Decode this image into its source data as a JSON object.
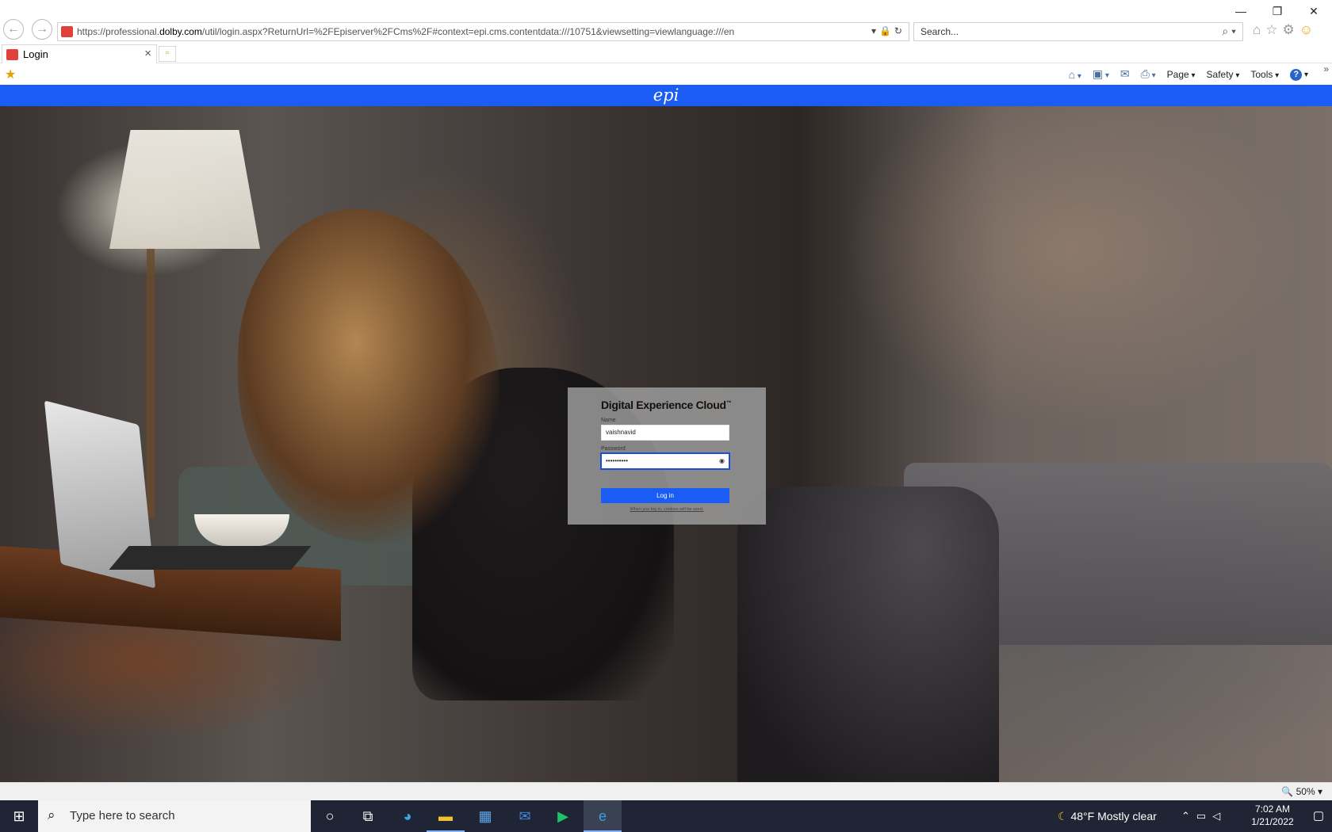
{
  "browser": {
    "url_prefix": "https://professional.",
    "url_domain": "dolby.com",
    "url_suffix": "/util/login.aspx?ReturnUrl=%2FEpiserver%2FCms%2F#context=epi.cms.contentdata:///10751&viewsetting=viewlanguage:///en",
    "search_placeholder": "Search...",
    "tab_title": "Login",
    "commands": {
      "page": "Page",
      "safety": "Safety",
      "tools": "Tools",
      "help": "?"
    },
    "zoom": "50%"
  },
  "epi": {
    "logo": "epi"
  },
  "login": {
    "brand": "Digital Experience Cloud",
    "brand_tm": "™",
    "name_label": "Name",
    "name_value": "vaishnavid",
    "password_label": "Password",
    "password_value": "••••••••••",
    "login_button": "Log in",
    "cookie_note": "When you log in, cookies will be used."
  },
  "taskbar": {
    "search_placeholder": "Type here to search",
    "weather_temp": "48°F",
    "weather_text": "Mostly clear",
    "time": "7:02 AM",
    "date": "1/21/2022"
  },
  "colors": {
    "epi_blue": "#1b5cf4",
    "taskbar": "#1f2535",
    "favicon": "#e0413a"
  }
}
